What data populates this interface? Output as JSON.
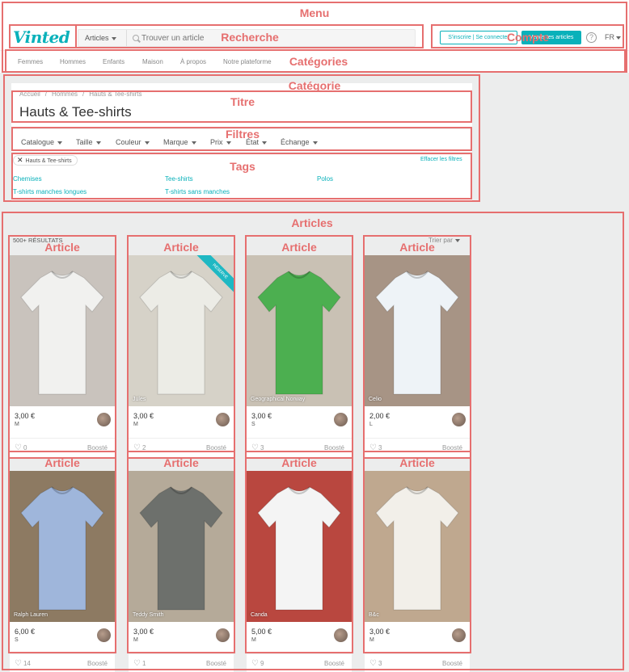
{
  "annotations": {
    "menu": "Menu",
    "recherche": "Recherche",
    "compte": "Compte",
    "categories": "Catégories",
    "categorie": "Catégorie",
    "titre": "Titre",
    "filtres": "Filtres",
    "tags": "Tags",
    "articles": "Articles",
    "article": "Article"
  },
  "header": {
    "logo": "Vinted",
    "search": {
      "category": "Articles",
      "placeholder": "Trouver un article"
    },
    "signup_label": "S'inscrire | Se connecter",
    "sell_label": "Vends tes articles",
    "help": "?",
    "lang": "FR"
  },
  "nav": [
    "Femmes",
    "Hommes",
    "Enfants",
    "Maison",
    "À propos",
    "Notre plateforme"
  ],
  "breadcrumb": [
    "Accueil",
    "Hommes",
    "Hauts & Tee-shirts"
  ],
  "page_title": "Hauts & Tee-shirts",
  "filters": [
    "Catalogue",
    "Taille",
    "Couleur",
    "Marque",
    "Prix",
    "État",
    "Échange"
  ],
  "active_chip": "Hauts & Tee-shirts",
  "clear_filters": "Effacer les filtres",
  "tags": [
    "Chemises",
    "Tee-shirts",
    "Polos",
    "T-shirts manches longues",
    "T-shirts sans manches"
  ],
  "results": {
    "count": "500+ RÉSULTATS",
    "sort": "Trier par"
  },
  "articles": [
    {
      "brand": "",
      "price": "3,00 €",
      "size": "M",
      "likes": "0",
      "boost": "Boosté",
      "shirt_color": "#f1f1ef",
      "bg": "#c9c3bd",
      "badge": ""
    },
    {
      "brand": "Jules",
      "price": "3,00 €",
      "size": "M",
      "likes": "2",
      "boost": "Boosté",
      "shirt_color": "#ecece6",
      "bg": "#d6d2c8",
      "badge": "RÉSERVÉ"
    },
    {
      "brand": "Geographical Norway",
      "price": "3,00 €",
      "size": "S",
      "likes": "3",
      "boost": "Boosté",
      "shirt_color": "#4caf50",
      "bg": "#c9c1b4",
      "badge": ""
    },
    {
      "brand": "Celio",
      "price": "2,00 €",
      "size": "L",
      "likes": "3",
      "boost": "Boosté",
      "shirt_color": "#eef3f7",
      "bg": "#a79485",
      "badge": ""
    },
    {
      "brand": "Ralph Lauren",
      "price": "6,00 €",
      "size": "S",
      "likes": "14",
      "boost": "Boosté",
      "shirt_color": "#9fb6db",
      "bg": "#8d7a62",
      "badge": ""
    },
    {
      "brand": "Teddy Smith",
      "price": "3,00 €",
      "size": "M",
      "likes": "1",
      "boost": "Boosté",
      "shirt_color": "#6d706c",
      "bg": "#b5aa99",
      "badge": ""
    },
    {
      "brand": "Canda",
      "price": "5,00 €",
      "size": "M",
      "likes": "9",
      "boost": "Boosté",
      "shirt_color": "#f4f4f4",
      "bg": "#b9473f",
      "badge": ""
    },
    {
      "brand": "B&c",
      "price": "3,00 €",
      "size": "M",
      "likes": "3",
      "boost": "Boosté",
      "shirt_color": "#f2efe9",
      "bg": "#bfa88f",
      "badge": ""
    }
  ],
  "colors": {
    "accent": "#09b1ba",
    "annotation": "#e66f6f"
  }
}
